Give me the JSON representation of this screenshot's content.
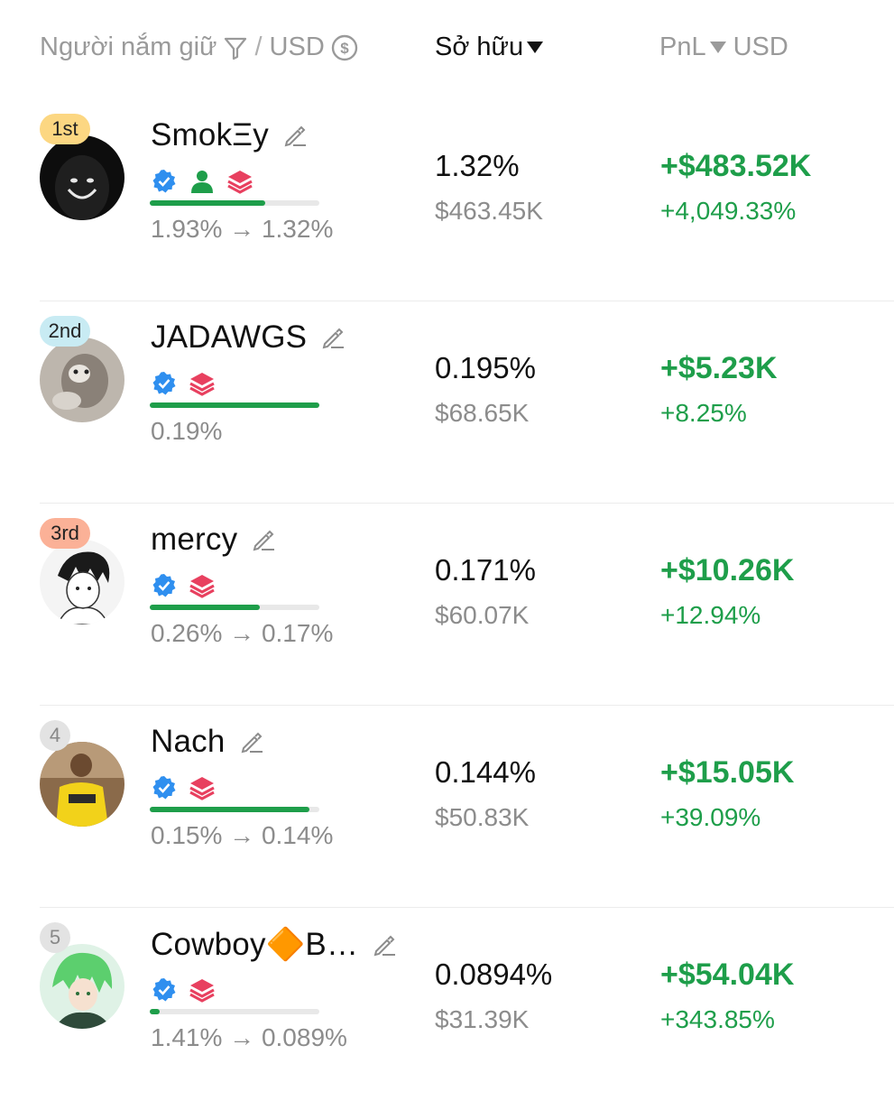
{
  "header": {
    "holders_label": "Người nắm giữ",
    "separator": "/",
    "currency_label": "USD",
    "ownership_label": "Sở hữu",
    "pnl_label": "PnL",
    "pnl_currency": "USD"
  },
  "holders": [
    {
      "rank": "1st",
      "name": "SmokΞy",
      "change": "1.93% → 1.32%",
      "ownership_pct": "1.32%",
      "ownership_usd": "$463.45K",
      "pnl_usd": "+$483.52K",
      "pnl_pct": "+4,049.33%",
      "progress": 0.68,
      "badges": [
        "verified-icon",
        "person-icon",
        "stack-icon"
      ]
    },
    {
      "rank": "2nd",
      "name": "JADAWGS",
      "change": "0.19%",
      "ownership_pct": "0.195%",
      "ownership_usd": "$68.65K",
      "pnl_usd": "+$5.23K",
      "pnl_pct": "+8.25%",
      "progress": 1.0,
      "badges": [
        "verified-icon",
        "stack-icon"
      ]
    },
    {
      "rank": "3rd",
      "name": "mercy",
      "change": "0.26% → 0.17%",
      "ownership_pct": "0.171%",
      "ownership_usd": "$60.07K",
      "pnl_usd": "+$10.26K",
      "pnl_pct": "+12.94%",
      "progress": 0.65,
      "badges": [
        "verified-icon",
        "stack-icon"
      ]
    },
    {
      "rank": "4",
      "name": "Nach",
      "change": "0.15% → 0.14%",
      "ownership_pct": "0.144%",
      "ownership_usd": "$50.83K",
      "pnl_usd": "+$15.05K",
      "pnl_pct": "+39.09%",
      "progress": 0.94,
      "badges": [
        "verified-icon",
        "stack-icon"
      ]
    },
    {
      "rank": "5",
      "name": "Cowboy🔶B…",
      "change": "1.41% → 0.089%",
      "ownership_pct": "0.0894%",
      "ownership_usd": "$31.39K",
      "pnl_usd": "+$54.04K",
      "pnl_pct": "+343.85%",
      "progress": 0.06,
      "badges": [
        "verified-icon",
        "stack-icon"
      ]
    }
  ],
  "colors": {
    "positive": "#1e9e4a",
    "muted": "#8c8c8c",
    "rank_1": "#fcd782",
    "rank_2": "#c8ebf3",
    "rank_3": "#fbb197",
    "rank_other": "#e3e3e3",
    "verified": "#2f8fef",
    "stack": "#e8405f"
  }
}
